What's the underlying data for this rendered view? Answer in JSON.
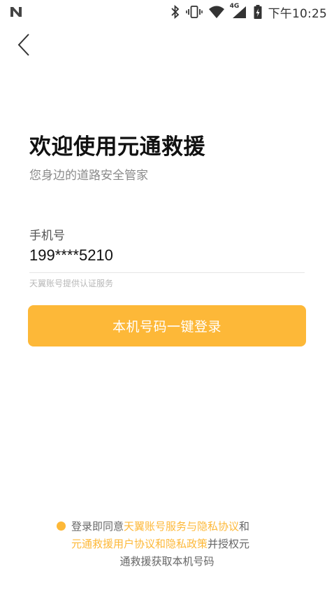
{
  "status_bar": {
    "time": "下午10:25",
    "network_label": "4G"
  },
  "header": {
    "title": "欢迎使用元通救援",
    "subtitle": "您身边的道路安全管家"
  },
  "phone_field": {
    "label": "手机号",
    "value": "199****5210",
    "hint": "天翼账号提供认证服务"
  },
  "login_button": {
    "label": "本机号码一键登录"
  },
  "agreement": {
    "prefix": "登录即同意",
    "link1": "天翼账号服务与隐私协议",
    "and": "和",
    "link2": "元通救援用户协议和隐私政策",
    "suffix1": "并授权元",
    "suffix2": "通救援获取本机号码"
  },
  "colors": {
    "accent": "#fdb838",
    "title": "#111111",
    "subtitle": "#8a8a8a",
    "hint": "#b8b8b8"
  },
  "icons": [
    "n-notification-icon",
    "bluetooth-icon",
    "vibrate-icon",
    "wifi-icon",
    "signal-icon",
    "battery-icon",
    "back-arrow-icon",
    "check-circle-icon"
  ]
}
